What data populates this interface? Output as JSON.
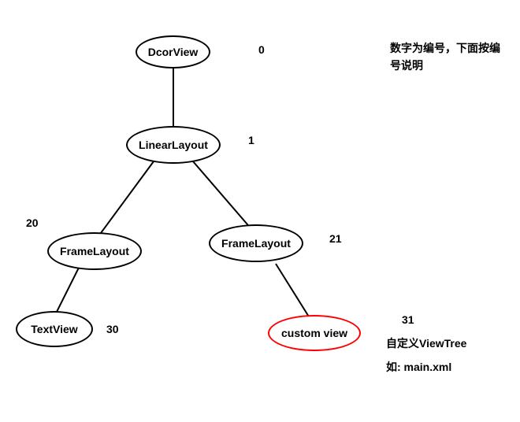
{
  "nodes": {
    "decor": {
      "label": "DcorView",
      "num": "0"
    },
    "linear": {
      "label": "LinearLayout",
      "num": "1"
    },
    "frameL": {
      "label": "FrameLayout",
      "num": "20"
    },
    "frameR": {
      "label": "FrameLayout",
      "num": "21"
    },
    "text": {
      "label": "TextView",
      "num": "30"
    },
    "custom": {
      "label": "custom view",
      "num": "31"
    }
  },
  "notes": {
    "top": "数字为编号，下面按编号说明",
    "custom1": "自定义ViewTree",
    "custom2": "如: main.xml"
  }
}
